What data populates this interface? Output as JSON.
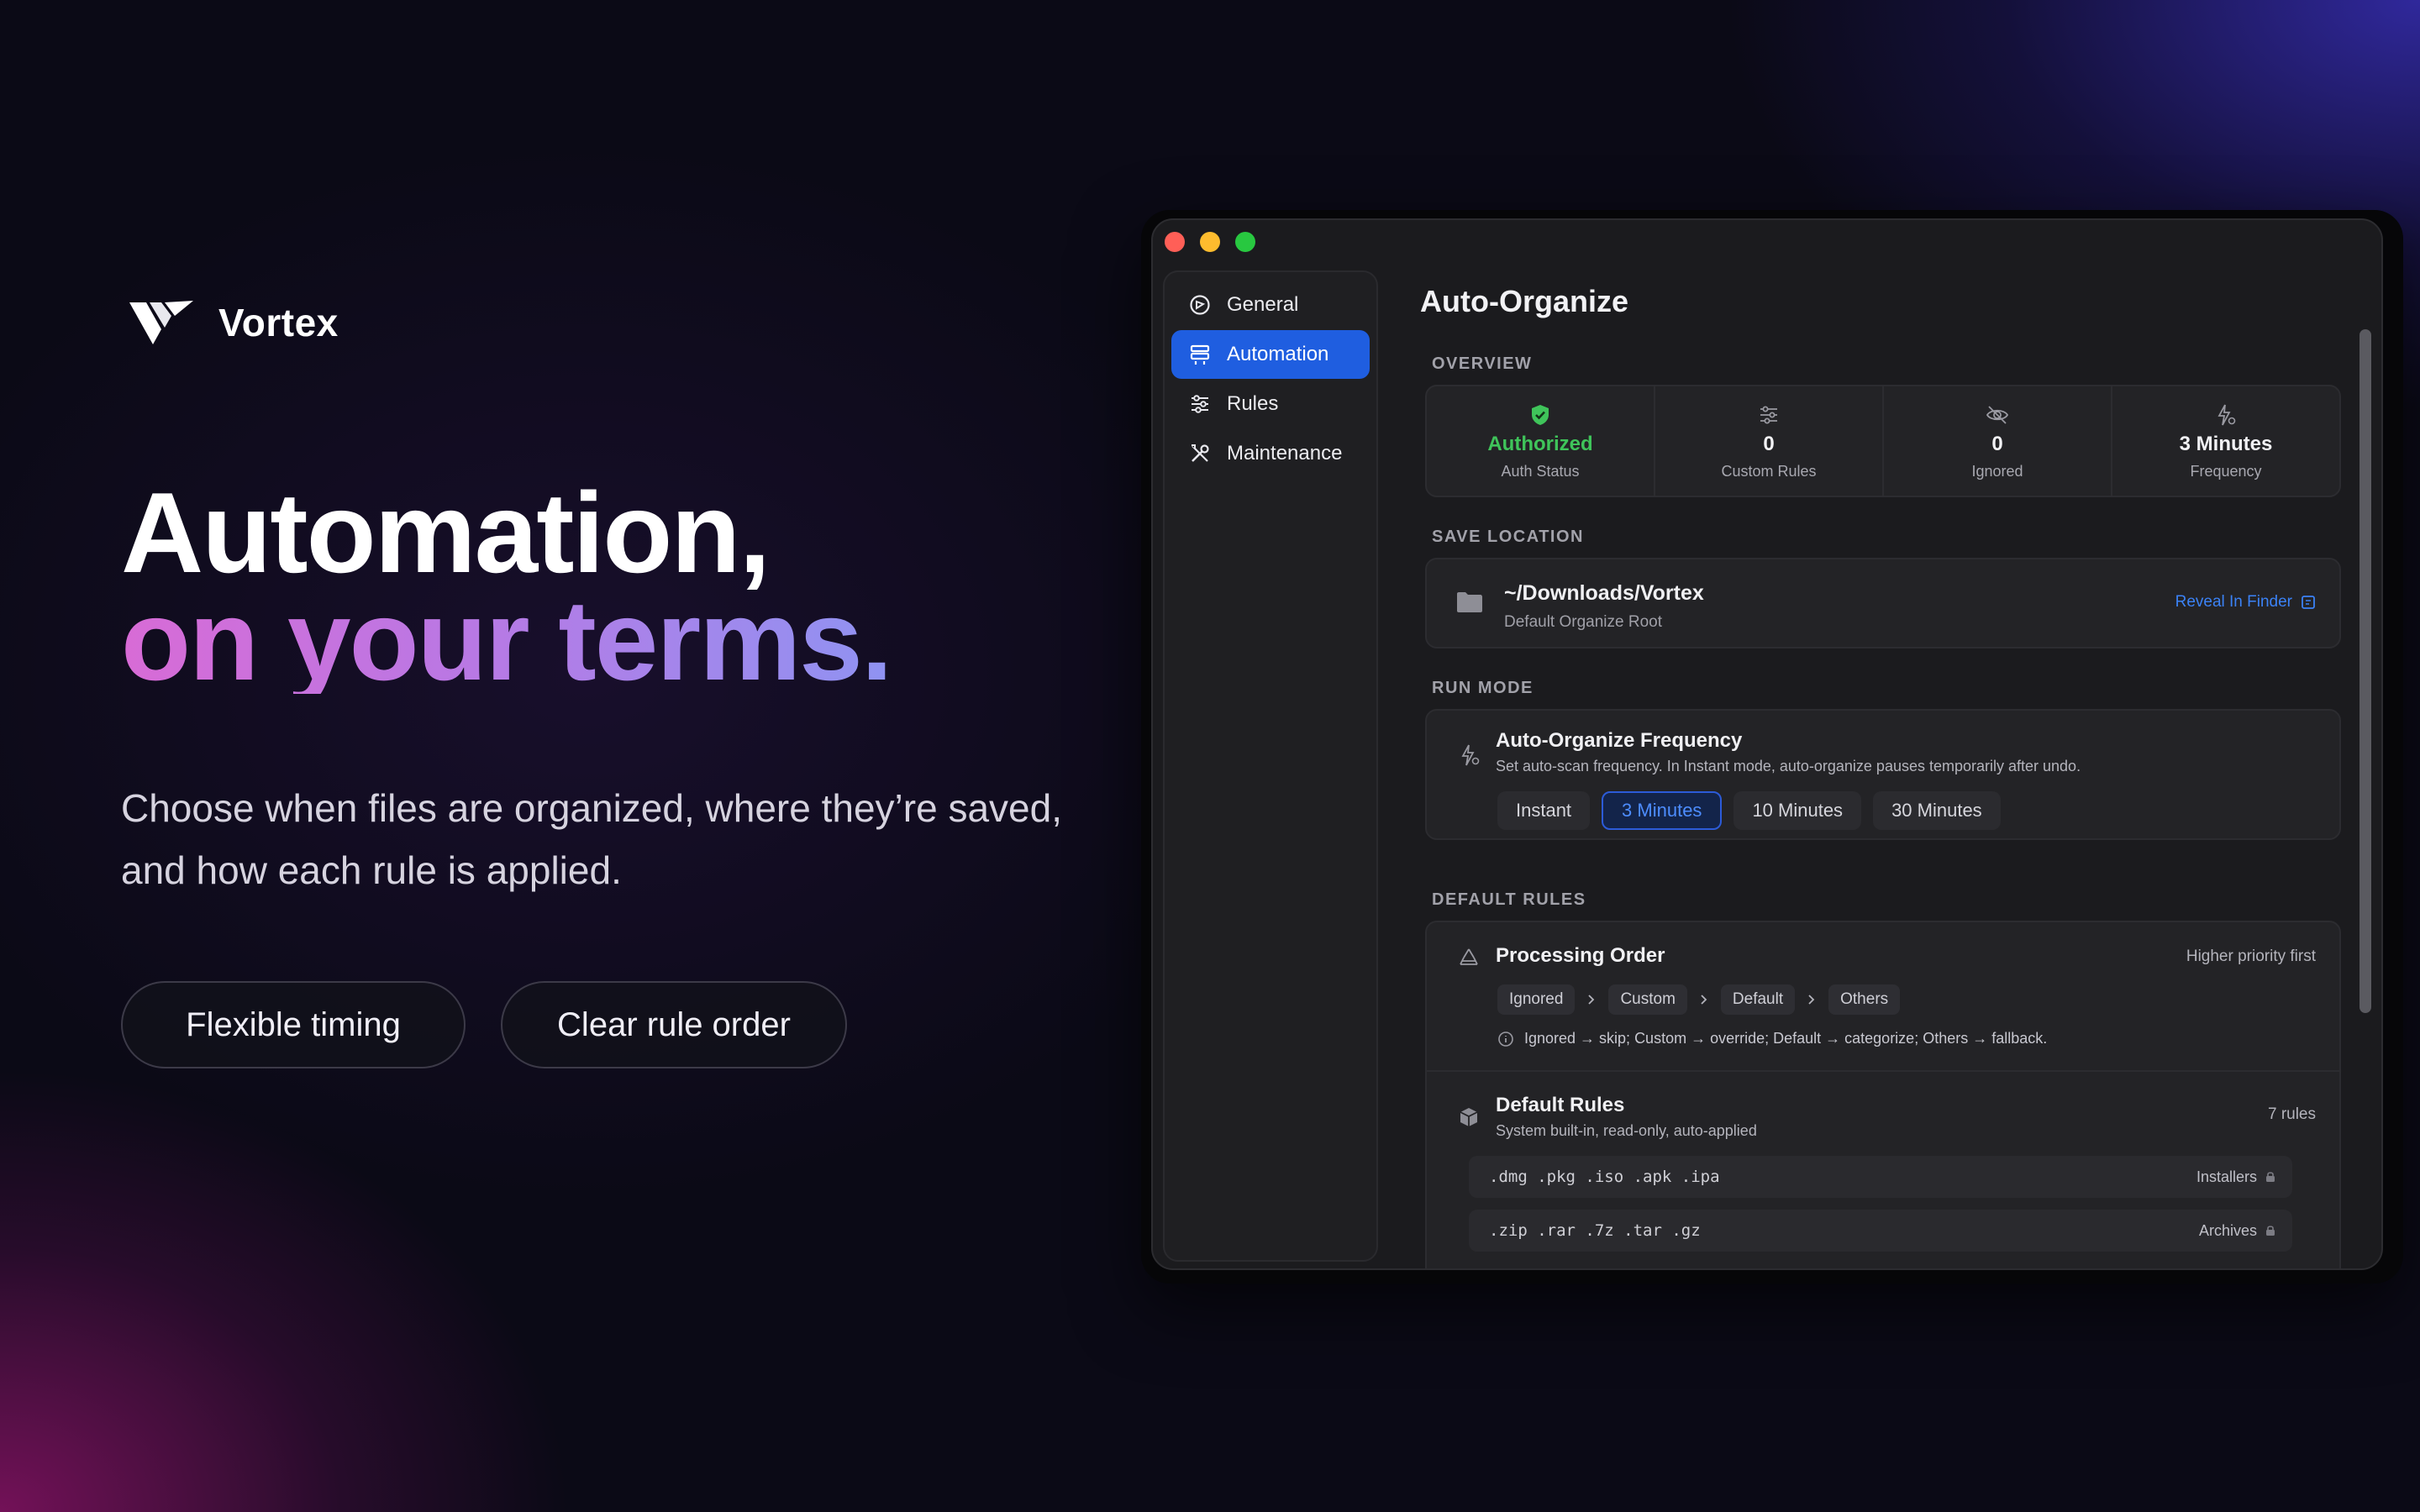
{
  "brand": {
    "name": "Vortex"
  },
  "hero": {
    "line1": "Automation,",
    "line2": "on your terms.",
    "sub1": "Choose when files are organized, where they’re saved,",
    "sub2": "and how each rule is applied.",
    "pill1": "Flexible timing",
    "pill2": "Clear rule order"
  },
  "colors": {
    "accent": "#1f5ee0",
    "success": "#3fc45a",
    "link": "#3b82f6",
    "gradient_start": "#d86bd6",
    "gradient_end": "#8f93f2"
  },
  "window": {
    "sidebar": [
      {
        "label": "General",
        "icon": "general-icon"
      },
      {
        "label": "Automation",
        "icon": "automation-icon"
      },
      {
        "label": "Rules",
        "icon": "sliders-icon"
      },
      {
        "label": "Maintenance",
        "icon": "tools-icon"
      }
    ],
    "title": "Auto-Organize",
    "overview": {
      "heading": "OVERVIEW",
      "stats": [
        {
          "value": "Authorized",
          "label": "Auth Status",
          "icon": "shield-check-icon"
        },
        {
          "value": "0",
          "label": "Custom Rules",
          "icon": "sliders-icon"
        },
        {
          "value": "0",
          "label": "Ignored",
          "icon": "eye-slash-icon"
        },
        {
          "value": "3 Minutes",
          "label": "Frequency",
          "icon": "bolt-icon"
        }
      ]
    },
    "save_location": {
      "heading": "SAVE LOCATION",
      "path": "~/Downloads/Vortex",
      "desc": "Default Organize Root",
      "reveal": "Reveal In Finder"
    },
    "run_mode": {
      "heading": "RUN MODE",
      "title": "Auto-Organize Frequency",
      "desc": "Set auto-scan frequency. In Instant mode, auto-organize pauses temporarily after undo.",
      "options": [
        "Instant",
        "3 Minutes",
        "10 Minutes",
        "30 Minutes"
      ],
      "selected": "3 Minutes"
    },
    "default_rules": {
      "heading": "DEFAULT RULES",
      "order_title": "Processing Order",
      "order_hint": "Higher priority first",
      "order": [
        "Ignored",
        "Custom",
        "Default",
        "Others"
      ],
      "order_note": "Ignored → skip; Custom → override; Default → categorize; Others → fallback.",
      "rules_title": "Default Rules",
      "rules_desc": "System built-in, read-only, auto-applied",
      "rules_count": "7 rules",
      "rows": [
        {
          "exts": ".dmg .pkg .iso .apk .ipa",
          "category": "Installers"
        },
        {
          "exts": ".zip .rar .7z .tar .gz",
          "category": "Archives"
        }
      ]
    }
  }
}
